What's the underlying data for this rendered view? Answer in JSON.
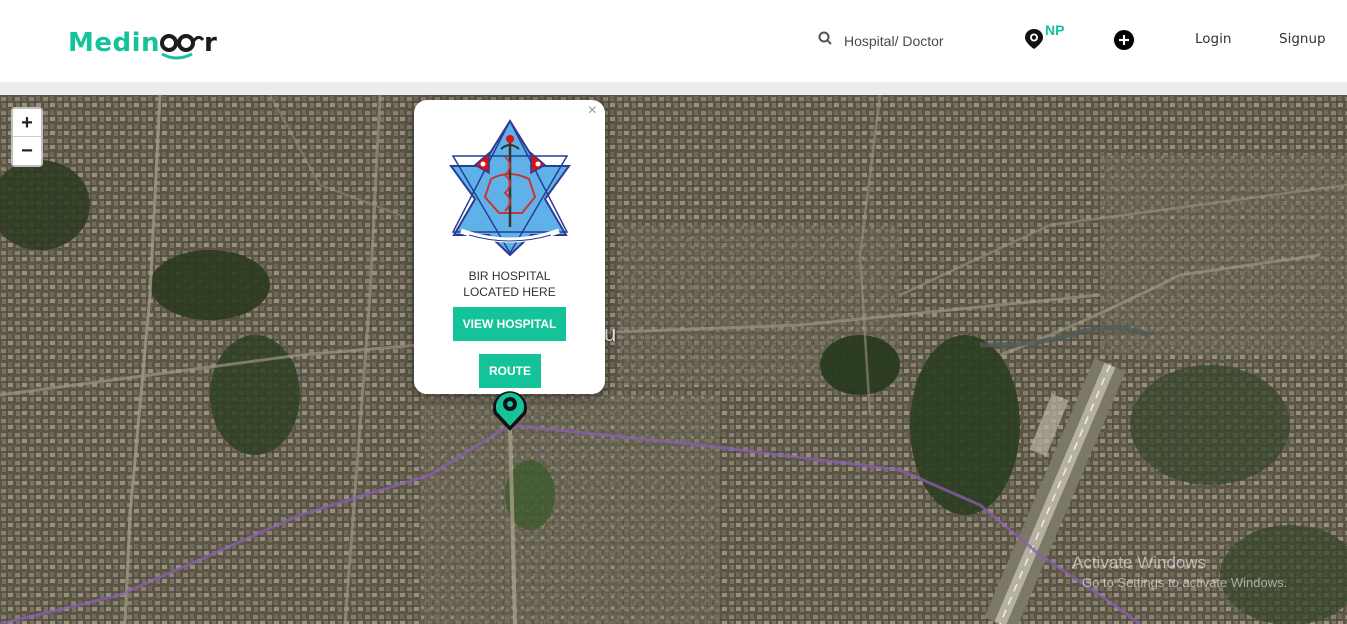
{
  "header": {
    "logo_text_start": "Medin",
    "logo_text_end": "r",
    "search_placeholder": "Hospital/ Doctor",
    "country_code": "NP",
    "login_label": "Login",
    "signup_label": "Signup"
  },
  "map": {
    "zoom_in_label": "+",
    "zoom_out_label": "−",
    "partial_place_label": "u",
    "popup": {
      "close_label": "×",
      "name_line1": "BIR HOSPITAL",
      "name_line2": "LOCATED HERE",
      "view_button": "VIEW HOSPITAL",
      "route_button": "ROUTE"
    },
    "watermark": {
      "title": "Activate Windows",
      "subtitle": "Go to Settings to activate Windows."
    }
  },
  "colors": {
    "brand_teal": "#15c39a",
    "route_line": "#8a5fb0"
  },
  "icons": [
    "search-icon",
    "location-pin-icon",
    "add-circle-icon",
    "hospital-emblem-icon",
    "map-marker-icon",
    "close-icon"
  ]
}
